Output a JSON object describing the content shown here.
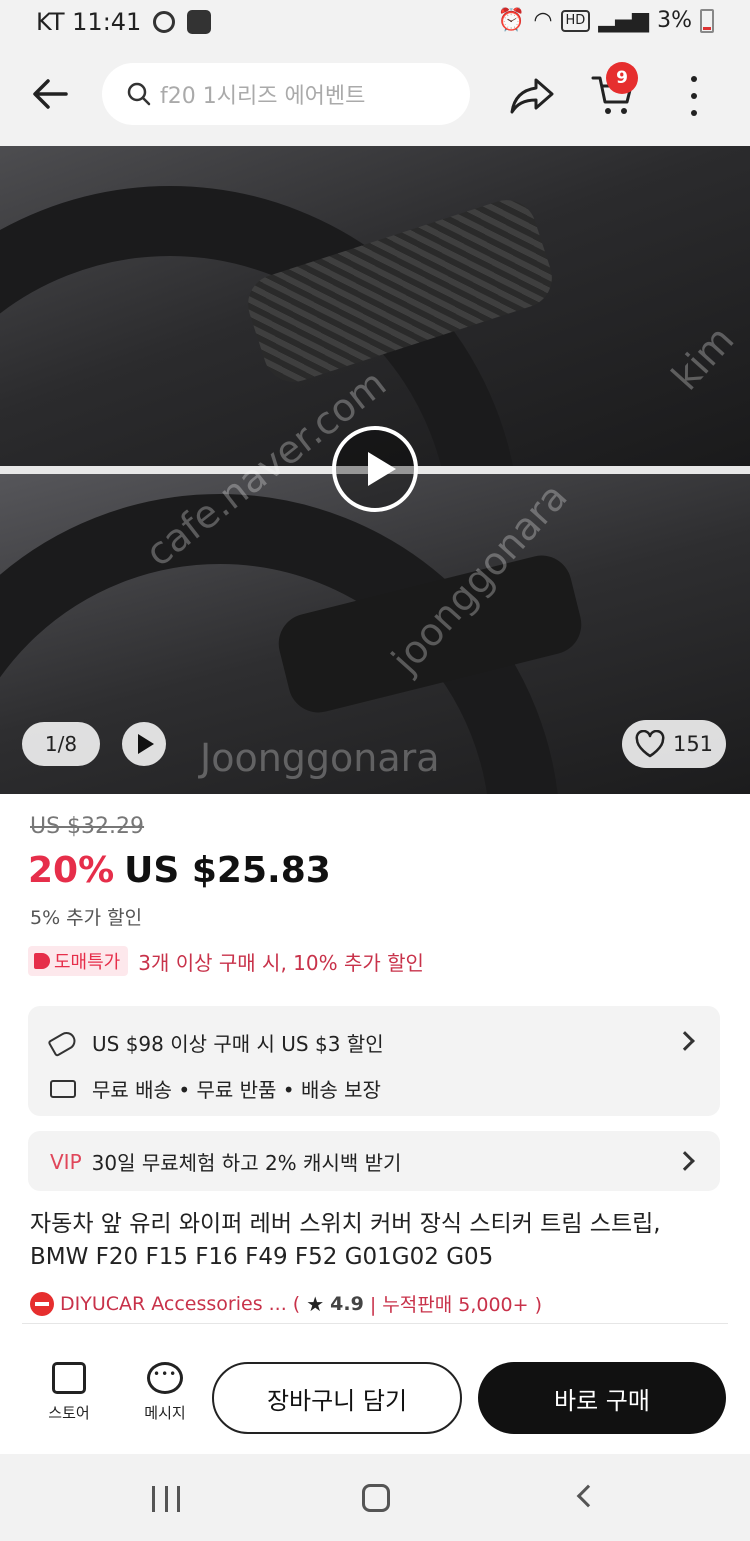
{
  "status_bar": {
    "carrier_time": "KT 11:41",
    "network": "HD",
    "battery": "3%"
  },
  "header": {
    "search_placeholder": "f20 1시리즈 에어벤트",
    "cart_count": "9"
  },
  "gallery": {
    "pager": "1/8",
    "likes": "151",
    "watermarks": [
      "cafe.naver.com",
      "joonggonara",
      "kim",
      "Joonggonara"
    ]
  },
  "price": {
    "original": "US $32.29",
    "discount": "20%",
    "current": "US $25.83",
    "extra": "5% 추가 할인",
    "wholesale_tag": "도매특가",
    "wholesale_text": "3개 이상 구매 시, 10% 추가 할인"
  },
  "promos": {
    "coupon": "US $98 이상 구매 시 US $3 할인",
    "shipping": "무료 배송 • 무료 반품 • 배송 보장",
    "vip_label": "VIP",
    "vip_text": "30일 무료체험 하고 2% 캐시백 받기"
  },
  "product": {
    "title": "자동차 앞 유리 와이퍼 레버 스위치 커버 장식 스티커 트림 스트립, BMW F20 F15 F16 F49 F52 G01G02 G05",
    "store_name": "DIYUCAR Accessories ... (",
    "rating": "4.9",
    "sales": "| 누적판매 5,000+ )"
  },
  "actions": {
    "store_label": "스토어",
    "message_label": "메시지",
    "add_cart": "장바구니 담기",
    "buy_now": "바로 구매"
  },
  "colors": {
    "accent_red": "#e62e4a",
    "badge_red": "#e62e2e",
    "buy_button": "#111111"
  }
}
